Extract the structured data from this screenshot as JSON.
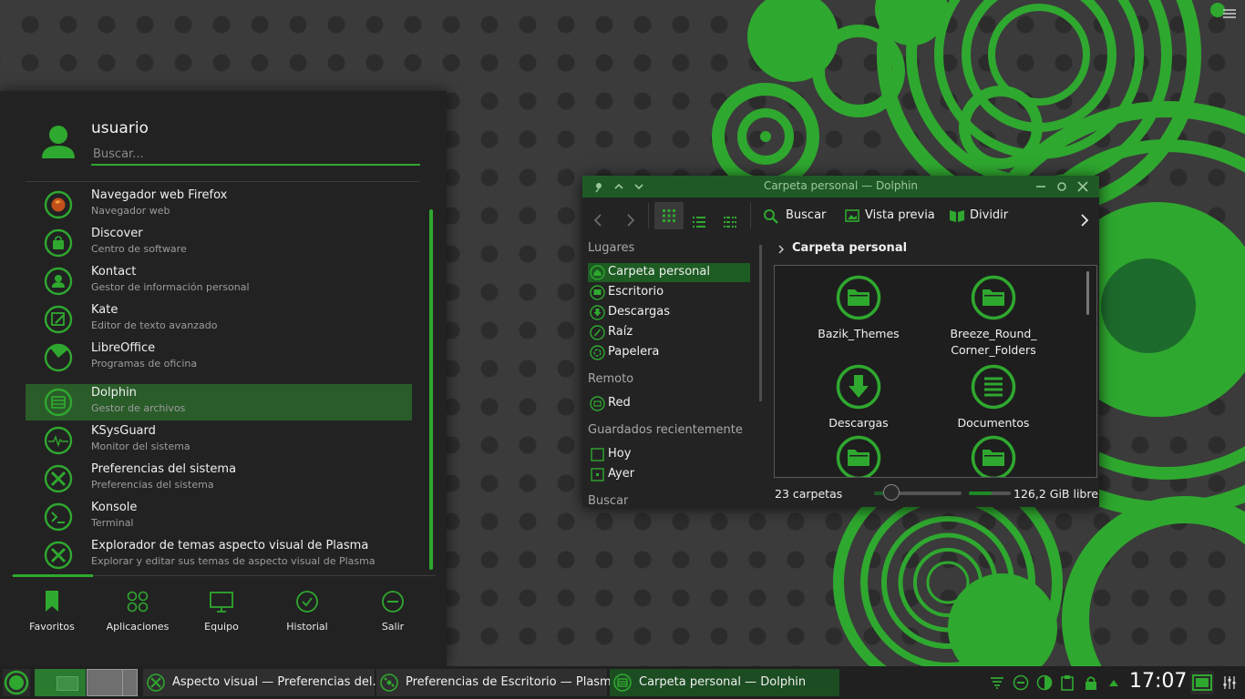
{
  "launcher": {
    "user": "usuario",
    "search_placeholder": "Buscar...",
    "apps": [
      {
        "name": "Navegador web Firefox",
        "desc": "Navegador web",
        "icon": "firefox-icon"
      },
      {
        "name": "Discover",
        "desc": "Centro de software",
        "icon": "discover-icon"
      },
      {
        "name": "Kontact",
        "desc": "Gestor de información personal",
        "icon": "kontact-icon"
      },
      {
        "name": "Kate",
        "desc": "Editor de texto avanzado",
        "icon": "kate-icon"
      },
      {
        "name": "LibreOffice",
        "desc": "Programas de oficina",
        "icon": "libreoffice-icon"
      },
      {
        "name": "Dolphin",
        "desc": "Gestor de archivos",
        "icon": "dolphin-icon"
      },
      {
        "name": "KSysGuard",
        "desc": "Monitor del sistema",
        "icon": "ksysguard-icon"
      },
      {
        "name": "Preferencias del sistema",
        "desc": "Preferencias del sistema",
        "icon": "system-settings-icon"
      },
      {
        "name": "Konsole",
        "desc": "Terminal",
        "icon": "konsole-icon"
      },
      {
        "name": "Explorador de temas aspecto visual de Plasma",
        "desc": "Explorar y editar sus temas de aspecto visual de Plasma",
        "icon": "theme-explorer-icon"
      }
    ],
    "active_app_index": 5,
    "tabs": [
      {
        "label": "Favoritos",
        "icon": "bookmark-icon"
      },
      {
        "label": "Aplicaciones",
        "icon": "applications-icon"
      },
      {
        "label": "Equipo",
        "icon": "computer-icon"
      },
      {
        "label": "Historial",
        "icon": "history-icon"
      },
      {
        "label": "Salir",
        "icon": "leave-icon"
      }
    ]
  },
  "dolphin": {
    "title": "Carpeta personal — Dolphin",
    "toolbar": {
      "search": "Buscar",
      "preview": "Vista previa",
      "split": "Dividir"
    },
    "places": {
      "header_places": "Lugares",
      "items": [
        {
          "label": "Carpeta personal",
          "icon": "home-icon"
        },
        {
          "label": "Escritorio",
          "icon": "desktop-icon"
        },
        {
          "label": "Descargas",
          "icon": "downloads-icon"
        },
        {
          "label": "Raíz",
          "icon": "root-icon"
        },
        {
          "label": "Papelera",
          "icon": "trash-icon"
        }
      ],
      "header_remote": "Remoto",
      "remote_items": [
        {
          "label": "Red",
          "icon": "network-icon"
        }
      ],
      "header_recent": "Guardados recientemente",
      "recent_items": [
        {
          "label": "Hoy",
          "icon": "today-icon"
        },
        {
          "label": "Ayer",
          "icon": "yesterday-icon"
        }
      ],
      "header_search": "Buscar"
    },
    "breadcrumb": "Carpeta personal",
    "files": [
      {
        "name": "Bazik_Themes",
        "icon": "folder-icon"
      },
      {
        "name": "Breeze_Round_\nCorner_Folders",
        "icon": "folder-icon"
      },
      {
        "name": "Descargas",
        "icon": "downloads-folder-icon"
      },
      {
        "name": "Documentos",
        "icon": "documents-folder-icon"
      },
      {
        "name": "",
        "icon": "folder-icon"
      },
      {
        "name": "",
        "icon": "folder-icon"
      }
    ],
    "status": {
      "folders": "23 carpetas",
      "free": "126,2 GiB libre",
      "zoom_fraction": 0.2,
      "used_fraction": 0.55
    }
  },
  "taskbar": {
    "tasks": [
      {
        "label": "Aspecto visual  — Preferencias del...",
        "icon": "settings-task-icon"
      },
      {
        "label": "Preferencias de Escritorio — Plasma",
        "icon": "plasma-task-icon"
      },
      {
        "label": "Carpeta personal — Dolphin",
        "icon": "dolphin-task-icon"
      }
    ],
    "clock": "17:07"
  },
  "colors": {
    "accent": "#2fa82f",
    "dark_green": "#1f5a26",
    "panel": "#222222"
  }
}
